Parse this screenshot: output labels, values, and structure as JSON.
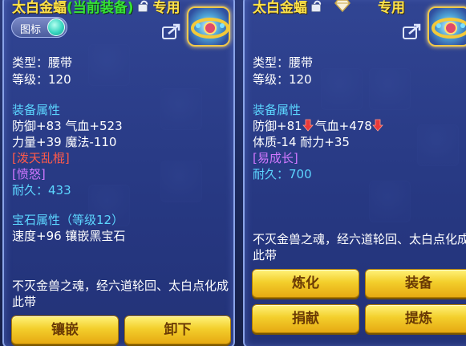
{
  "left": {
    "item_name": "太白金蝠",
    "equipped_tag": "(当前装备)",
    "exclusive_label": "专用",
    "toggle_label": "图标",
    "type_line": "类型：腰带",
    "level_line": "等级：120",
    "section_attr": "装备属性",
    "attr_line1": "防御+83 气血+523",
    "attr_line2": "力量+39 魔法-110",
    "special1": "[泼天乱棍]",
    "special2": "[愤怒]",
    "durability_label": "耐久：",
    "durability_value": "433",
    "section_gem": "宝石属性（等级12）",
    "gem_line": "速度+96 镶嵌黑宝石",
    "description": "不灭金兽之魂，经六道轮回、太白点化成此带",
    "btn_inlay": "镶嵌",
    "btn_remove": "卸下"
  },
  "right": {
    "item_name": "太白金蝠",
    "exclusive_label": "专用",
    "type_line": "类型：腰带",
    "level_line": "等级：120",
    "section_attr": "装备属性",
    "attr_def": "防御+81",
    "attr_hp": "气血+478",
    "attr_line2": "体质-14 耐力+35",
    "special1": "[易成长]",
    "durability_label": "耐久：",
    "durability_value": "700",
    "description": "不灭金兽之魂，经六道轮回、太白点化成此带",
    "btn_refine": "炼化",
    "btn_equip": "装备",
    "btn_donate": "捐献",
    "btn_extract": "提炼"
  },
  "colors": {
    "title_gold": "#ffe34a",
    "equipped_green": "#36e236",
    "section_cyan": "#5cd6ff",
    "special_red": "#ff5a4a",
    "special_purple": "#d078ff",
    "button_gold": "#f3cf2c",
    "down_arrow_red": "#e83a3a"
  },
  "icons": [
    "lock-icon",
    "diamond-icon",
    "share-icon",
    "belt-item-icon",
    "down-arrow-icon"
  ]
}
